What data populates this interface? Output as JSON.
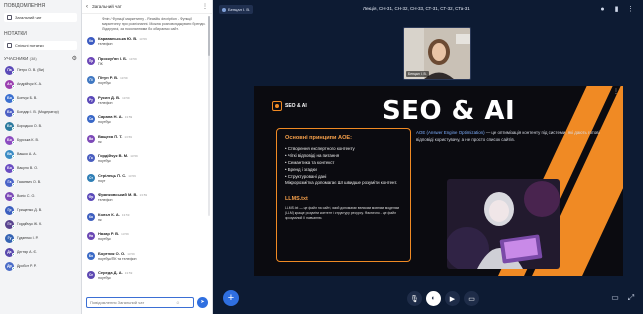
{
  "sidebar": {
    "messages_heading": "ПОВІДОМЛЕННЯ",
    "public_chat_label": "Загальний чат",
    "notes_heading": "НОТАТКИ",
    "shared_notes_label": "Спільні нотатки",
    "users_heading": "УЧАСНИКИ",
    "users_count": "(38)",
    "users": [
      {
        "initials": "Па",
        "name": "Петро О. В. (Ви)",
        "color": "#5b4ab8"
      },
      {
        "initials": "Ан",
        "name": "Андрійчук К. А.",
        "color": "#9b3fb0"
      },
      {
        "initials": "Бо",
        "name": "Бончук Б. В.",
        "color": "#3a6fd0"
      },
      {
        "initials": "Бо",
        "name": "Бондар І. В. (Модератор)",
        "color": "#4c5fc4"
      },
      {
        "initials": "Бо",
        "name": "Бородько О. В.",
        "color": "#2c7a9e"
      },
      {
        "initials": "Бо",
        "name": "Бурська К. В.",
        "color": "#8c4bc0"
      },
      {
        "initials": "Ва",
        "name": "Вашко А. А.",
        "color": "#3a8bc4"
      },
      {
        "initials": "Бо",
        "name": "Вакуло В. О.",
        "color": "#6a4cc2"
      },
      {
        "initials": "Га",
        "name": "Гаскевич О. В.",
        "color": "#4a63c8"
      },
      {
        "initials": "Во",
        "name": "Вопіс С. О.",
        "color": "#7b49b6"
      },
      {
        "initials": "Гр",
        "name": "Грищенко Д. В.",
        "color": "#3b5fbf"
      },
      {
        "initials": "Го",
        "name": "Гордійчук Ж. К.",
        "color": "#59448f"
      },
      {
        "initials": "Гу",
        "name": "Гудзенко І. Р.",
        "color": "#3463b3"
      },
      {
        "initials": "Дє",
        "name": "Дєгтяр А. Є.",
        "color": "#5747ac"
      },
      {
        "initials": "Др",
        "name": "Дробот Р. Р.",
        "color": "#4a6cc7"
      }
    ]
  },
  "chat": {
    "title": "Загальний чат",
    "previous_message": "Фліп / Функції маркетингу - Reaslitu decription - Функції маркетингу при розпізнанні. Можна розповсюджувати бренди. Лідируючі, за посиланнями бо обираємо сайт.",
    "messages": [
      {
        "initials": "Ка",
        "name": "Караваньська Ю. В.",
        "time": "13:59",
        "text": "телефон",
        "color": "#3c5bc2"
      },
      {
        "initials": "Пр",
        "name": "Проскуґян І. Б.",
        "time": "13:59",
        "text": "ПК",
        "color": "#6c48b8"
      },
      {
        "initials": "Пі",
        "name": "Пітун Р. В.",
        "time": "13:59",
        "text": "ноутбук",
        "color": "#3f78c2"
      },
      {
        "initials": "Ру",
        "name": "Русин Д. В.",
        "time": "13:59",
        "text": "телефон",
        "color": "#5a49b9"
      },
      {
        "initials": "Са",
        "name": "Сарана Н. А.",
        "time": "13:59",
        "text": "ноутбук",
        "color": "#3a68c8"
      },
      {
        "initials": "Ва",
        "name": "Ващеха П. Т.",
        "time": "13:59",
        "text": "пк",
        "color": "#7d4ab8"
      },
      {
        "initials": "Го",
        "name": "Гордійчук В. М.",
        "time": "13:59",
        "text": "ноутбук",
        "color": "#4a5ec0"
      },
      {
        "initials": "Ст",
        "name": "Стрілець П. С.",
        "time": "13:59",
        "text": "ноут",
        "color": "#2f7fb6"
      },
      {
        "initials": "Фр",
        "name": "Франковський М. В.",
        "time": "13:59",
        "text": "телефон",
        "color": "#5a49b9"
      },
      {
        "initials": "Ко",
        "name": "Колєл К. А.",
        "time": "13:59",
        "text": "пк",
        "color": "#3e5fbf"
      },
      {
        "initials": "На",
        "name": "Назар Р. В.",
        "time": "13:59",
        "text": "ноутбук",
        "color": "#6b47b4"
      },
      {
        "initials": "Бо",
        "name": "Бортник О. О.",
        "time": "13:59",
        "text": "ноутбук/ПК та телефон",
        "color": "#3b6ac6"
      },
      {
        "initials": "Се",
        "name": "Середа Д. А.",
        "time": "13:59",
        "text": "ноутбук",
        "color": "#5d48b2"
      }
    ],
    "input_placeholder": "Повідомлення Загальний чат"
  },
  "main": {
    "presenter_label": "Бенцал І. В.",
    "meeting_title": "Лекція, СН-31, СН-32, СН-33, СТ-31, СТ-32, СТа-31",
    "webcam_label": "Бенцал І. В.",
    "slide": {
      "logo_text": "SEO & AI",
      "title": "SEO & AI",
      "principles_title": "Основні принципи AOE:",
      "principles": [
        "Створення експертного контенту",
        "Чіткі відповіді на питання",
        "Семантика та контекст",
        "Бренд і згадки",
        "Структуровані дані"
      ],
      "principles_note": "Мікророзмітка допомагає ШІ швидше розуміти контент.",
      "llms_title": "LLMS.txt",
      "llms_desc": "LLMS.txt — це файл на сайті, який допомагає великим мовним моделям (LLM) краще розуміти контент і структуру ресурсу. Фактично - це файл зрозумілий ІІ навчанню.",
      "aoe_highlight": "AOE (Answer Engine Optimization)",
      "aoe_rest": "— це оптимізація контенту під системи, які дають готові відповіді користувачу, а не просто список сайтів."
    }
  },
  "colors": {
    "accent": "#f08a24",
    "primary_blue": "#2f6fe0",
    "main_bg": "#0d1b33"
  }
}
